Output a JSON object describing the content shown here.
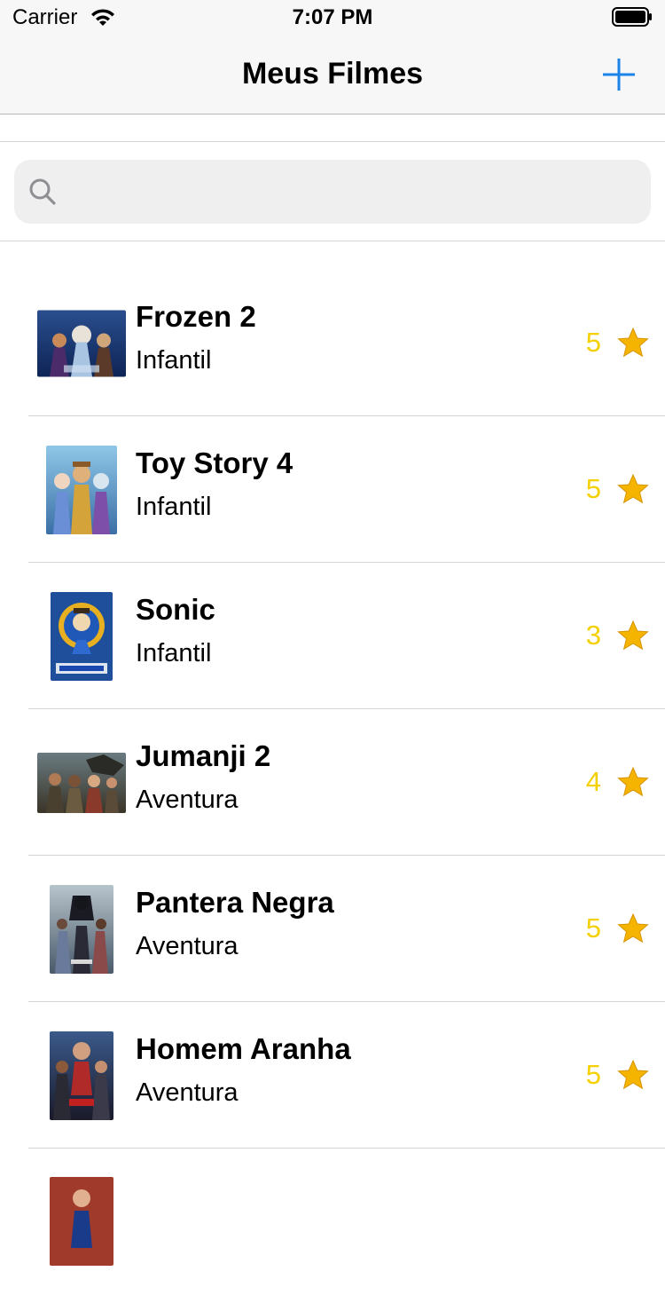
{
  "status": {
    "carrier": "Carrier",
    "time": "7:07 PM"
  },
  "nav": {
    "title": "Meus Filmes",
    "add_icon": "plus-icon"
  },
  "search": {
    "placeholder": "",
    "value": ""
  },
  "colors": {
    "accent": "#1a82e8",
    "rating": "#f5d000",
    "star": "#f4b400"
  },
  "movies": [
    {
      "title": "Frozen 2",
      "genre": "Infantil",
      "rating": "5"
    },
    {
      "title": "Toy Story 4",
      "genre": "Infantil",
      "rating": "5"
    },
    {
      "title": "Sonic",
      "genre": "Infantil",
      "rating": "3"
    },
    {
      "title": "Jumanji 2",
      "genre": "Aventura",
      "rating": "4"
    },
    {
      "title": "Pantera Negra",
      "genre": "Aventura",
      "rating": "5"
    },
    {
      "title": "Homem Aranha",
      "genre": "Aventura",
      "rating": "5"
    },
    {
      "title": "",
      "genre": "",
      "rating": ""
    }
  ]
}
